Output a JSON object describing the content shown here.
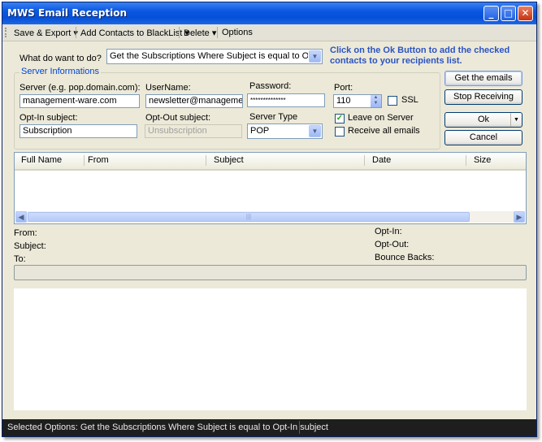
{
  "window": {
    "title": "MWS Email Reception"
  },
  "menu": {
    "save_export": "Save & Export ▾",
    "add_blacklist": "Add Contacts to BlackList ▾",
    "delete": "Delete ▾",
    "options": "Options"
  },
  "todo": {
    "label": "What do want to do?",
    "selected": "Get the Subscriptions Where Subject is equal to Opt-In s"
  },
  "hint": "Click on the Ok Button to add the checked contacts to your recipients list.",
  "server_group": {
    "title": "Server Informations",
    "server_label": "Server (e.g. pop.domain.com):",
    "server_value": "management-ware.com",
    "username_label": "UserName:",
    "username_value": "newsletter@management-",
    "password_label": "Password:",
    "password_value": "**************",
    "port_label": "Port:",
    "port_value": "110",
    "ssl_label": "SSL",
    "optin_label": "Opt-In subject:",
    "optin_value": "Subscription",
    "optout_label": "Opt-Out subject:",
    "optout_value": "Unsubscription",
    "server_type_label": "Server Type",
    "server_type_value": "POP",
    "leave_on_server_label": "Leave on Server",
    "receive_all_label": "Receive all emails"
  },
  "buttons": {
    "get_emails": "Get the emails",
    "stop_receiving": "Stop Receiving",
    "ok": "Ok",
    "cancel": "Cancel"
  },
  "table": {
    "columns": [
      "Full Name",
      "From",
      "Subject",
      "Date",
      "Size"
    ]
  },
  "details": {
    "from": "From:",
    "subject": "Subject:",
    "to": "To:",
    "optin": "Opt-In:",
    "optout": "Opt-Out:",
    "bounce": "Bounce Backs:"
  },
  "status": {
    "text": "Selected Options: Get the Subscriptions Where Subject is equal to Opt-In subject"
  },
  "icons": {
    "minimize": "minimize-icon",
    "maximize": "maximize-icon",
    "close": "close-icon"
  },
  "colors": {
    "titlebar": "#0a58e0",
    "hint": "#2b54c4",
    "group_title": "#0046d5"
  }
}
